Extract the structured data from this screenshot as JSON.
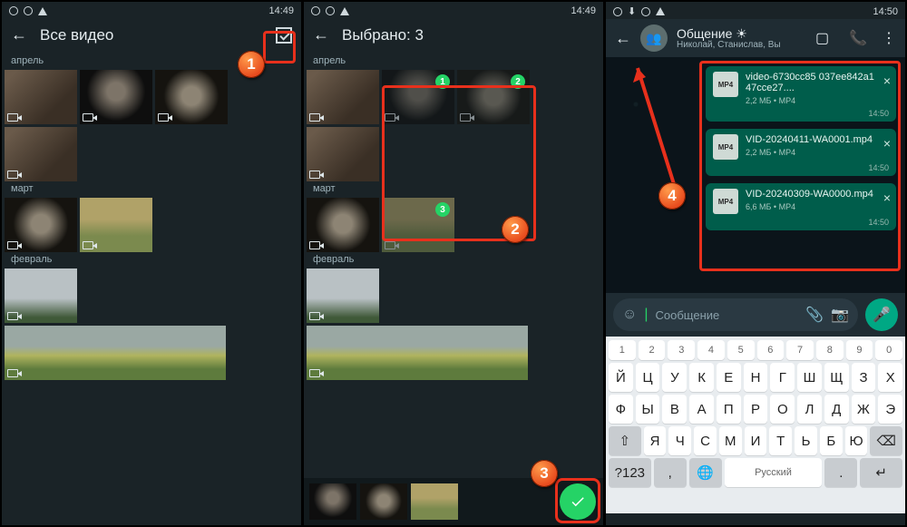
{
  "status": {
    "time1": "14:49",
    "time3": "14:50"
  },
  "p1": {
    "title": "Все видео",
    "sections": {
      "april": "апрель",
      "march": "март",
      "february": "февраль"
    }
  },
  "p2": {
    "title": "Выбрано: 3",
    "sections": {
      "april": "апрель",
      "march": "март",
      "february": "февраль"
    },
    "checks": [
      "1",
      "2",
      "3"
    ]
  },
  "p3": {
    "chat_title": "Общение ☀",
    "chat_sub": "Николай, Станислав, Вы",
    "messages": [
      {
        "name": "video-6730cc85 037ee842a147cce27....",
        "meta": "2,2 МБ • MP4",
        "time": "14:50",
        "icon": "MP4"
      },
      {
        "name": "VID-20240411-WA0001.mp4",
        "meta": "2,2 МБ • MP4",
        "time": "14:50",
        "icon": "MP4"
      },
      {
        "name": "VID-20240309-WA0000.mp4",
        "meta": "6,6 МБ • MP4",
        "time": "14:50",
        "icon": "MP4"
      }
    ],
    "input_placeholder": "Сообщение"
  },
  "keyboard": {
    "nums": [
      "1",
      "2",
      "3",
      "4",
      "5",
      "6",
      "7",
      "8",
      "9",
      "0"
    ],
    "row1": [
      "Й",
      "Ц",
      "У",
      "К",
      "Е",
      "Н",
      "Г",
      "Ш",
      "Щ",
      "З",
      "Х"
    ],
    "row2": [
      "Ф",
      "Ы",
      "В",
      "А",
      "П",
      "Р",
      "О",
      "Л",
      "Д",
      "Ж",
      "Э"
    ],
    "row3": [
      "Я",
      "Ч",
      "С",
      "М",
      "И",
      "Т",
      "Ь",
      "Б",
      "Ю"
    ],
    "bottom": {
      "num": "?123",
      "comma": ",",
      "lang": "Русский",
      "dot": ".",
      "enter": "↵"
    }
  },
  "callouts": {
    "c1": "1",
    "c2": "2",
    "c3": "3",
    "c4": "4"
  }
}
